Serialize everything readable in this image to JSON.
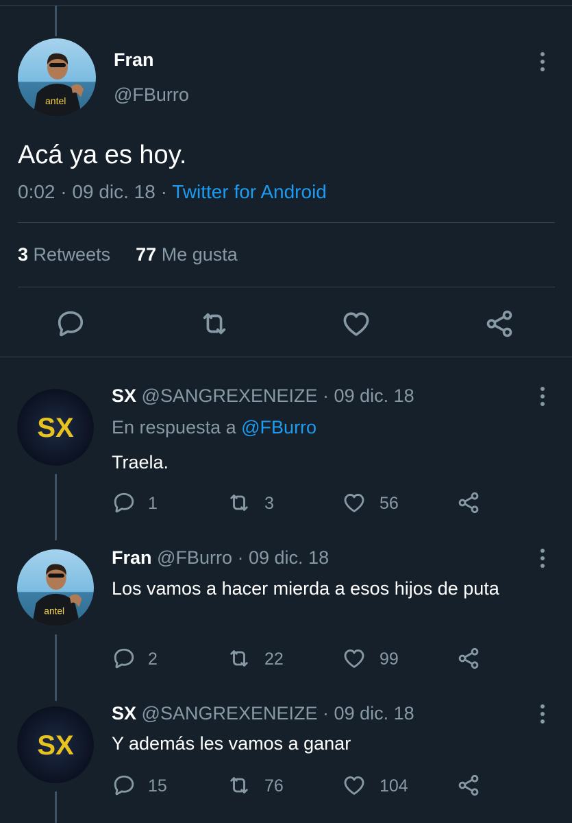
{
  "main_tweet": {
    "name": "Fran",
    "handle": "@FBurro",
    "text": "Acá ya es hoy.",
    "time": "0:02",
    "sep1": "·",
    "date": "09 dic. 18",
    "sep2": "·",
    "source": "Twitter for Android",
    "retweets_count": "3",
    "retweets_label": "Retweets",
    "likes_count": "77",
    "likes_label": "Me gusta",
    "avatar_text": "antel"
  },
  "replies": [
    {
      "name": "SX",
      "handle": "@SANGREXENEIZE",
      "sep": "·",
      "date": "09 dic. 18",
      "reply_prefix": "En respuesta a",
      "reply_to": "@FBurro",
      "text": "Traela.",
      "replies": "1",
      "retweets": "3",
      "likes": "56",
      "avatar_text": "SX"
    },
    {
      "name": "Fran",
      "handle": "@FBurro",
      "sep": "·",
      "date": "09 dic. 18",
      "text": "Los vamos a hacer mierda a esos hijos de puta",
      "replies": "2",
      "retweets": "22",
      "likes": "99",
      "avatar_text": "antel"
    },
    {
      "name": "SX",
      "handle": "@SANGREXENEIZE",
      "sep": "·",
      "date": "09 dic. 18",
      "text": "Y además les vamos a ganar",
      "replies": "15",
      "retweets": "76",
      "likes": "104",
      "avatar_text": "SX"
    }
  ],
  "colors": {
    "background": "#15202b",
    "secondary_text": "#8899a6",
    "link": "#1d9bf0",
    "divider": "#38444d",
    "sx_logo": "#e8c21e"
  },
  "icons": [
    "reply-icon",
    "retweet-icon",
    "like-icon",
    "share-icon",
    "more-icon"
  ]
}
